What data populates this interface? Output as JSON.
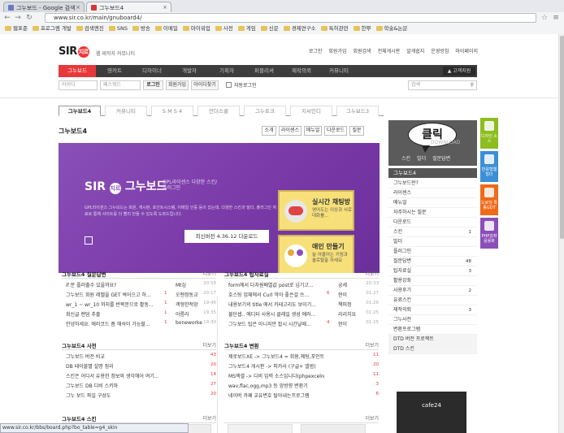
{
  "browser": {
    "tabs": [
      {
        "title": "그누보드 - Google 검색",
        "active": false
      },
      {
        "title": "그누보드4",
        "active": true
      }
    ],
    "url": "www.sir.co.kr/main/gnuboard4/",
    "bookmarks": [
      "웹표준",
      "프로그램 개발",
      "검색엔진",
      "SNS",
      "방송",
      "이메일",
      "마이워업",
      "사전",
      "게임",
      "신문",
      "경제연구소",
      "특허관련",
      "한뿌",
      "학술&논문"
    ]
  },
  "site": {
    "logo": "SIR",
    "logo_badge": "지르",
    "tagline": "웹 제작자 커뮤니티",
    "top_links": [
      "로그인",
      "회원가입",
      "회원검색",
      "전체게시판",
      "알게쉽지",
      "운영방침",
      "마이페이지"
    ],
    "gnb": [
      "그누보드",
      "영카트",
      "디자이너",
      "개발자",
      "기획자",
      "퍼블리셔",
      "제작의뢰",
      "커뮤니티"
    ],
    "support": "고객지원",
    "login": {
      "id_placeholder": "아이디",
      "pw_placeholder": "패스워드",
      "login_btn": "로그인",
      "join_btn": "회원가입",
      "find_btn": "아이디찾기",
      "auto_login": "자동로그인",
      "search_placeholder": "검색"
    }
  },
  "subtabs": [
    "그누보드4",
    "커뮤니티",
    "S M S 4",
    "언더스쿨",
    "그누토크",
    "지씨인디",
    "그누보드3"
  ],
  "board": {
    "title": "그누보드4",
    "buttons": [
      "소개",
      "라이센스",
      "매뉴얼",
      "다운로드",
      "질문"
    ],
    "banner": {
      "name": "그누보드",
      "gpl": "GPL라이센스 다양한 스킨/플러그인",
      "desc": "GPL라이센스 그누보드는 회원, 게시판, 포인트시스템, 이메일 인증 등이 있는데, 다양한 스킨과 빌더, 플러그인 자료로 통해 사이트를 더 빨리 만들 수 있도록 도와드립니다.",
      "version_btn": "최신버전 4.36.12 다운로드",
      "promo1": {
        "title": "실시간 채팅방",
        "sub": "영어도는 이상과 서로 대화를..."
      },
      "promo2": {
        "title": "애인 만들기",
        "sub": "늘 어울어는 키링과 솔로탈출 하세요"
      }
    }
  },
  "qna": {
    "title": "그누보드4 질문답변",
    "more": "더보기",
    "rows": [
      {
        "t": "if 문 플러출수 있을까요?",
        "c": "",
        "a": "Mt심",
        "d": "20:58"
      },
      {
        "t": "그누보드 회원 레벨을 GET 썩어으고 하...",
        "c": "1",
        "a": "오렌정동교",
        "d": "20:17"
      },
      {
        "t": "wr_1 ~ wr_10 까지를 반복문으로 활동...",
        "c": "1",
        "a": "객형한적망",
        "d": "19:46"
      },
      {
        "t": "회신글 랜덤 추출",
        "c": "1",
        "a": "아름라",
        "d": "19:35"
      },
      {
        "t": "안녕하세요. 에러코드 좀 해석이 가능할...",
        "c": "1",
        "a": "boneworke",
        "d": "19:30"
      }
    ]
  },
  "tips": {
    "title": "그누보드4 팁자료실",
    "more": "더보기",
    "rows": [
      {
        "t": "form에서 다차원배열값 post로 넘기고...",
        "c": "",
        "a": "궁세",
        "d": "20:33"
      },
      {
        "t": "호스팅 업체에서 Curl 막아 좋은걸 쓰...",
        "c": "6",
        "a": "현이",
        "d": "01.27"
      },
      {
        "t": "내용보기의 title 에서 카테고리도 보이기...",
        "c": "",
        "a": "책피정",
        "d": "01.26"
      },
      {
        "t": "불단셉.. 에디터 사용시 클래일 생성 에러...",
        "c": "",
        "a": "리리치요",
        "d": "01.25"
      },
      {
        "t": "그누보드 팁은 아니지만 잡시 시간날때...",
        "c": "4",
        "a": "현이",
        "d": "01.25"
      }
    ]
  },
  "tut": {
    "title": "그누보드4 사전",
    "more": "더보기",
    "rows": [
      {
        "t": "그누보드 버전 비교",
        "n": "43"
      },
      {
        "t": "DB 테이블별 설명 정리",
        "n": "20"
      },
      {
        "t": "스킨은 어디서 유용한 정보와 생각해어 여기...",
        "n": "14"
      },
      {
        "t": "그누보드 DB 디비 스키마",
        "n": "27"
      },
      {
        "t": "그누 보드 파일 구성도",
        "n": "20"
      }
    ]
  },
  "changes": {
    "title": "그누보드4 변환",
    "more": "더보기",
    "rows": [
      {
        "t": "제로보드XE -> 그누보드4 = 회원,쳬팅,포인트...",
        "n": "11"
      },
      {
        "t": "그누보드4 게시판 -> 피카사 (구글+ 앨범)",
        "n": "20"
      },
      {
        "t": "MS엑셀 -> 디비 입력 소스입니다(phpexcelreader...",
        "n": "11"
      },
      {
        "t": "wav,flac,ogg,mp3 등 앙방향 변환기",
        "n": "3"
      },
      {
        "t": "네이버 카페 교유변호 탈아내는프로그램",
        "n": "6"
      }
    ]
  },
  "skin": {
    "title": "그누보드4 스킨",
    "more": "더보기"
  },
  "side": {
    "bubble": "클릭",
    "download": "DOWNLOAD",
    "links": [
      "스킨",
      "빌더",
      "질문답변"
    ],
    "menu_title": "그누보드4",
    "menu": [
      {
        "label": "그누보드란?",
        "num": ""
      },
      {
        "label": "라이센스",
        "num": ""
      },
      {
        "label": "메뉴얼",
        "num": ""
      },
      {
        "label": "자주하시는 질문",
        "num": ""
      },
      {
        "label": "다운로드",
        "num": ""
      },
      {
        "label": "스킨",
        "num": "1"
      },
      {
        "label": "빌더",
        "num": ""
      },
      {
        "label": "플러그인",
        "num": ""
      },
      {
        "label": "질문답변",
        "num": "48"
      },
      {
        "label": "팁자료실",
        "num": "3"
      },
      {
        "label": "활용강좌",
        "num": ""
      },
      {
        "label": "사용후기",
        "num": "2"
      },
      {
        "label": "유료스킨",
        "num": ""
      },
      {
        "label": "제작의뢰",
        "num": "3"
      },
      {
        "label": "그누사전",
        "num": ""
      },
      {
        "label": "변환프로그램",
        "num": ""
      },
      {
        "label": "DTD 버전 프로젝트",
        "num": ""
      },
      {
        "label": "DTD 스킨",
        "num": ""
      }
    ],
    "icons": [
      {
        "label": "디자인 소스",
        "color": "#8dbd1f"
      },
      {
        "label": "반응형웹 빌더",
        "color": "#3a8fd6"
      },
      {
        "label": "드로잉 특종GDT",
        "color": "#f06a1a"
      },
      {
        "label": "PHP강좌 응용화",
        "color": "#8a4fb8"
      }
    ],
    "ad": "cafe24"
  },
  "status_bar": "www.sir.co.kr/bbs/board.php?bo_table=g4_skin"
}
